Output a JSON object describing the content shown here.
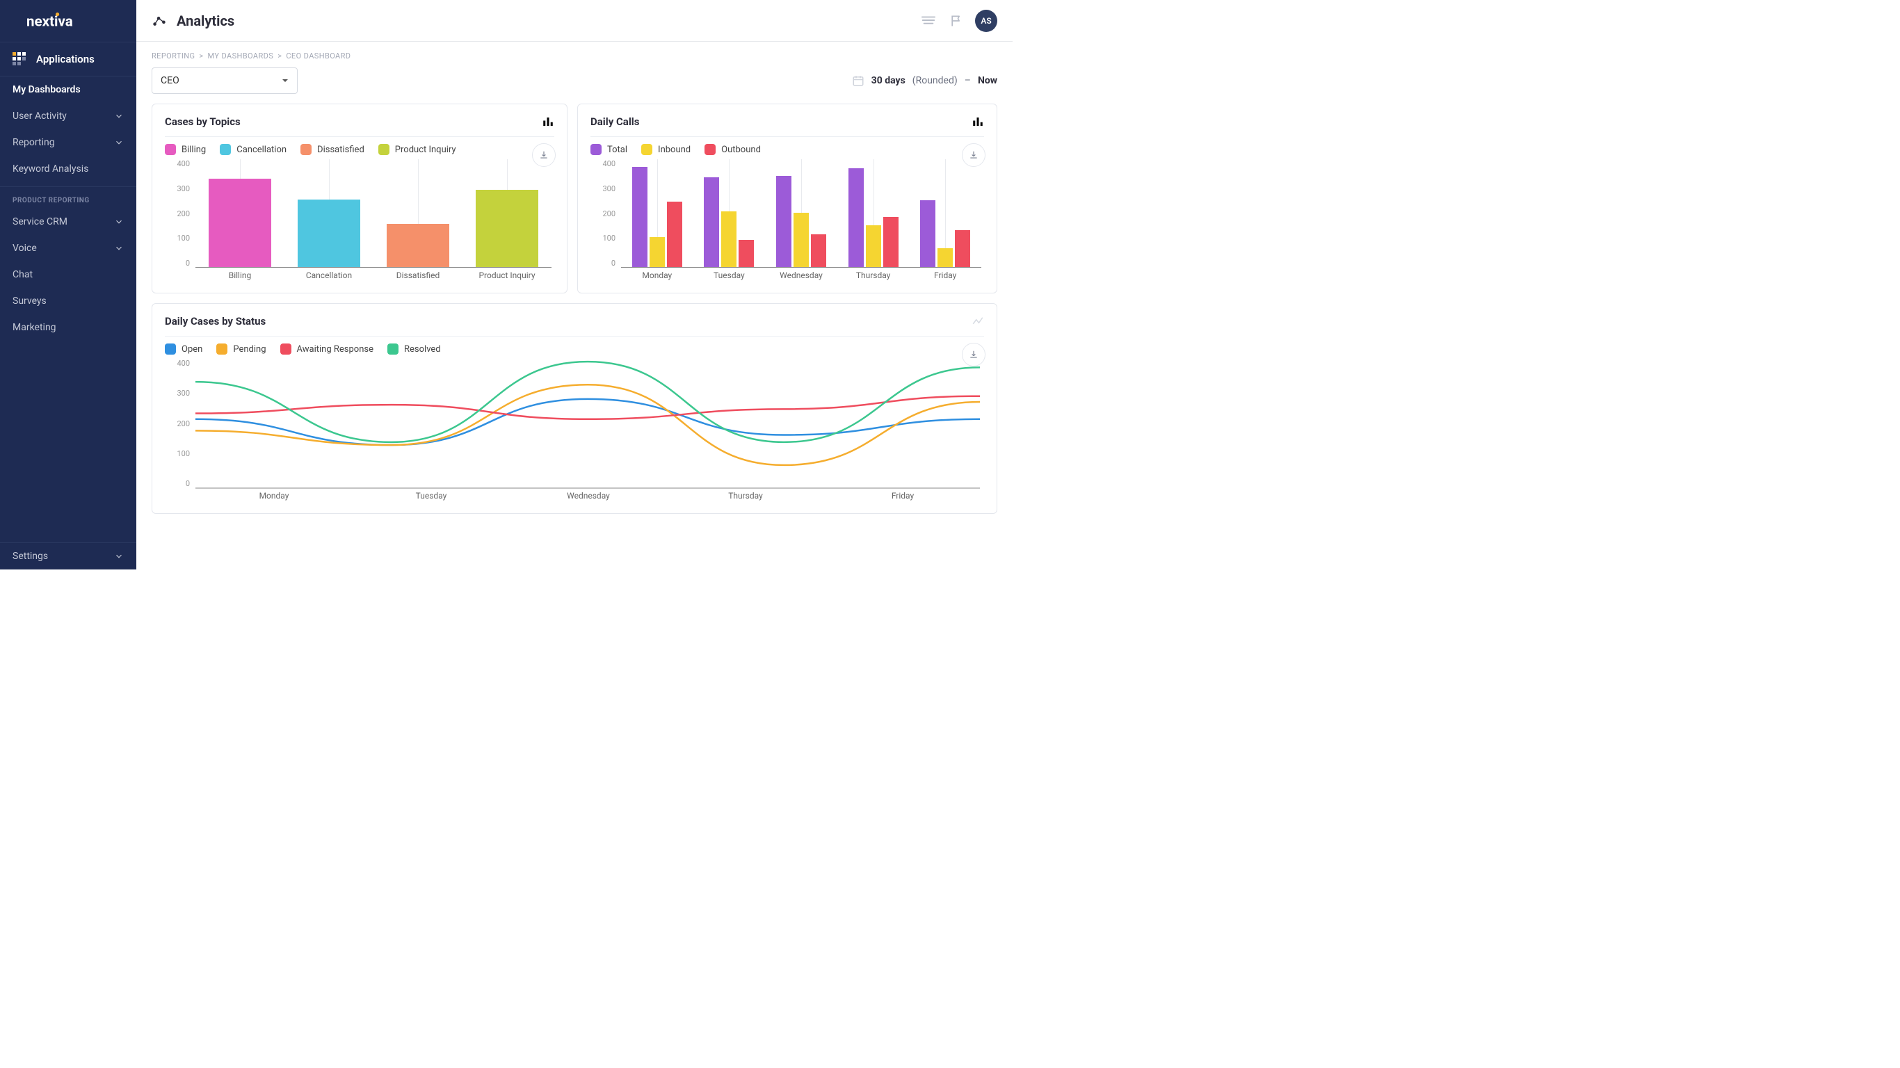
{
  "brand": "nextiva",
  "sidebar": {
    "apps_label": "Applications",
    "items": [
      {
        "label": "My Dashboards",
        "active": true,
        "chevron": false
      },
      {
        "label": "User Activity",
        "active": false,
        "chevron": true
      },
      {
        "label": "Reporting",
        "active": false,
        "chevron": true
      },
      {
        "label": "Keyword Analysis",
        "active": false,
        "chevron": false
      }
    ],
    "section_label": "PRODUCT REPORTING",
    "product_items": [
      {
        "label": "Service CRM",
        "chevron": true
      },
      {
        "label": "Voice",
        "chevron": true
      },
      {
        "label": "Chat",
        "chevron": false
      },
      {
        "label": "Surveys",
        "chevron": false
      },
      {
        "label": "Marketing",
        "chevron": false
      }
    ],
    "settings_label": "Settings"
  },
  "header": {
    "title": "Analytics",
    "avatar": "AS"
  },
  "breadcrumb": [
    "REPORTING",
    "MY DASHBOARDS",
    "CEO DASHBOARD"
  ],
  "dashboard_select": "CEO",
  "time_range": {
    "duration": "30 days",
    "rounded": "(Rounded)",
    "dash": "–",
    "now": "Now"
  },
  "colors": {
    "billing": "#e65bc0",
    "cancellation": "#4fc6e0",
    "dissatisfied": "#f5906a",
    "product_inquiry": "#c4d23c",
    "total": "#9c5bd8",
    "inbound": "#f5d531",
    "outbound": "#ef4d5e",
    "open": "#2f8fe0",
    "pending": "#f5ad2e",
    "awaiting": "#ef4d5e",
    "resolved": "#3cc78f"
  },
  "card1": {
    "title": "Cases by Topics",
    "legend": [
      {
        "key": "billing",
        "label": "Billing"
      },
      {
        "key": "cancellation",
        "label": "Cancellation"
      },
      {
        "key": "dissatisfied",
        "label": "Dissatisfied"
      },
      {
        "key": "product_inquiry",
        "label": "Product Inquiry"
      }
    ]
  },
  "card2": {
    "title": "Daily Calls",
    "legend": [
      {
        "key": "total",
        "label": "Total"
      },
      {
        "key": "inbound",
        "label": "Inbound"
      },
      {
        "key": "outbound",
        "label": "Outbound"
      }
    ]
  },
  "card3": {
    "title": "Daily Cases by Status",
    "legend": [
      {
        "key": "open",
        "label": "Open"
      },
      {
        "key": "pending",
        "label": "Pending"
      },
      {
        "key": "awaiting",
        "label": "Awaiting Response"
      },
      {
        "key": "resolved",
        "label": "Resolved"
      }
    ]
  },
  "chart_data": [
    {
      "id": "cases_by_topics",
      "type": "bar",
      "categories": [
        "Billing",
        "Cancellation",
        "Dissatisfied",
        "Product Inquiry"
      ],
      "values": [
        325,
        250,
        160,
        285
      ],
      "ylim": [
        0,
        400
      ],
      "yticks": [
        0,
        100,
        200,
        300,
        400
      ],
      "series_colors": [
        "billing",
        "cancellation",
        "dissatisfied",
        "product_inquiry"
      ]
    },
    {
      "id": "daily_calls",
      "type": "bar",
      "categories": [
        "Monday",
        "Tuesday",
        "Wednesday",
        "Thursday",
        "Friday"
      ],
      "series": [
        {
          "name": "Total",
          "key": "total",
          "values": [
            370,
            330,
            335,
            365,
            245
          ]
        },
        {
          "name": "Inbound",
          "key": "inbound",
          "values": [
            110,
            205,
            200,
            155,
            70
          ]
        },
        {
          "name": "Outbound",
          "key": "outbound",
          "values": [
            240,
            100,
            120,
            185,
            135
          ]
        }
      ],
      "ylim": [
        0,
        400
      ],
      "yticks": [
        0,
        100,
        200,
        300,
        400
      ]
    },
    {
      "id": "daily_cases_by_status",
      "type": "line",
      "categories": [
        "Monday",
        "Tuesday",
        "Wednesday",
        "Thursday",
        "Friday"
      ],
      "series": [
        {
          "name": "Open",
          "key": "open",
          "values": [
            240,
            150,
            310,
            185,
            240
          ]
        },
        {
          "name": "Pending",
          "key": "pending",
          "values": [
            200,
            150,
            360,
            80,
            300
          ]
        },
        {
          "name": "Awaiting Response",
          "key": "awaiting",
          "values": [
            260,
            290,
            240,
            275,
            320
          ]
        },
        {
          "name": "Resolved",
          "key": "resolved",
          "values": [
            370,
            160,
            440,
            160,
            420
          ]
        }
      ],
      "ylim": [
        0,
        450
      ],
      "yticks": [
        0,
        100,
        200,
        300,
        400
      ]
    }
  ]
}
